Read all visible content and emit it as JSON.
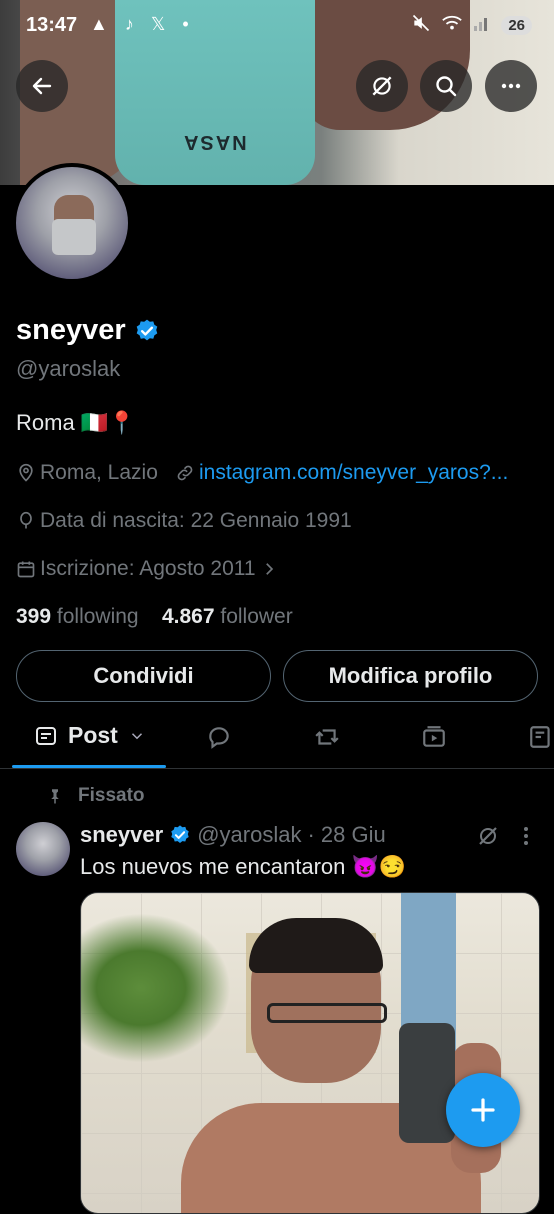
{
  "status_bar": {
    "time": "13:47",
    "left_icons": "▲ ♪ 𝕏 •",
    "battery": "26"
  },
  "profile": {
    "display_name": "sneyver",
    "handle": "@yaroslak",
    "bio": "Roma 🇮🇹📍",
    "location": "Roma, Lazio",
    "link": "instagram.com/sneyver_yaros?...",
    "birthday": "Data di nascita: 22 Gennaio 1991",
    "joined": "Iscrizione: Agosto 2011",
    "following_count": "399",
    "following_label": "following",
    "follower_count": "4.867",
    "follower_label": "follower"
  },
  "actions": {
    "share_label": "Condividi",
    "edit_label": "Modifica profilo"
  },
  "tabs": {
    "active_label": "Post"
  },
  "pinned_post": {
    "pinned_label": "Fissato",
    "author": "sneyver",
    "handle": "@yaroslak",
    "date": "· 28 Giu",
    "text": "Los nuevos me encantaron 😈😏"
  },
  "colors": {
    "accent": "#1d9bf0",
    "background": "#000000",
    "secondary_text": "#71767b"
  },
  "banner": {
    "shirt_text": "NASA"
  }
}
